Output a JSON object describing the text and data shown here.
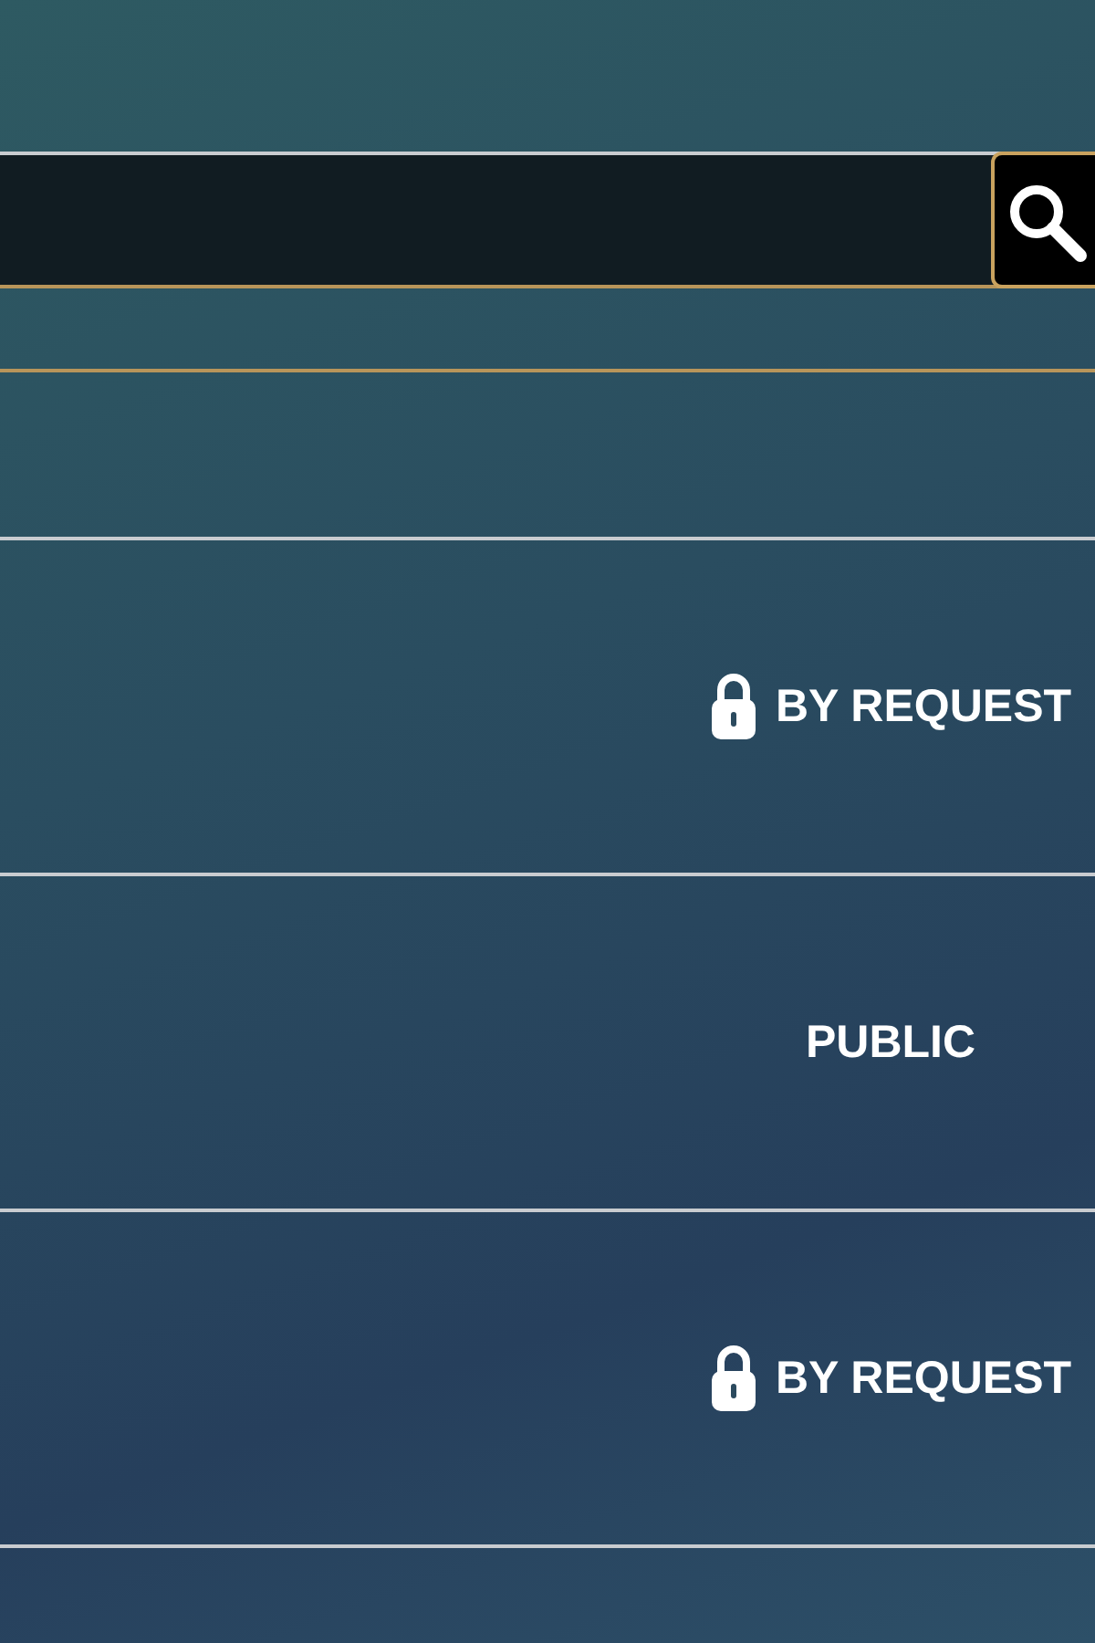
{
  "rows": [
    {
      "locked": false
    },
    {
      "label": "BY REQUEST",
      "locked": true
    },
    {
      "label": "PUBLIC",
      "locked": false
    },
    {
      "label": "BY REQUEST",
      "locked": true
    }
  ]
}
